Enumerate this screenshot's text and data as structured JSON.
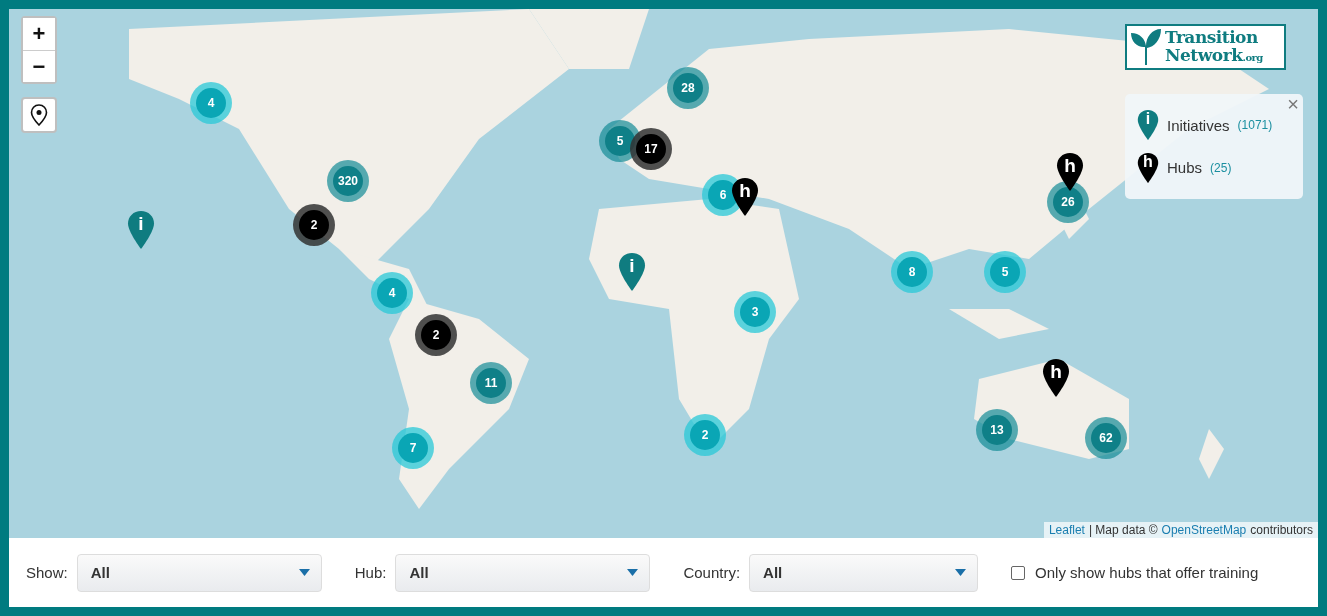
{
  "map": {
    "zoom_in": "+",
    "zoom_out": "−",
    "clusters": [
      {
        "count": "4",
        "kind": "small"
      },
      {
        "count": "320",
        "kind": "large"
      },
      {
        "count": "2",
        "kind": "hub"
      },
      {
        "count": "4",
        "kind": "small"
      },
      {
        "count": "2",
        "kind": "hub"
      },
      {
        "count": "11",
        "kind": "large"
      },
      {
        "count": "7",
        "kind": "small"
      },
      {
        "count": "28",
        "kind": "large"
      },
      {
        "count": "5",
        "kind": "large"
      },
      {
        "count": "17",
        "kind": "hub"
      },
      {
        "count": "6",
        "kind": "small"
      },
      {
        "count": "3",
        "kind": "small"
      },
      {
        "count": "2",
        "kind": "small"
      },
      {
        "count": "8",
        "kind": "small"
      },
      {
        "count": "5",
        "kind": "small"
      },
      {
        "count": "26",
        "kind": "large"
      },
      {
        "count": "13",
        "kind": "large"
      },
      {
        "count": "62",
        "kind": "large"
      }
    ],
    "pins": [
      {
        "label": "i",
        "kind": "initiative"
      },
      {
        "label": "i",
        "kind": "initiative"
      },
      {
        "label": "h",
        "kind": "hub"
      },
      {
        "label": "h",
        "kind": "hub"
      },
      {
        "label": "h",
        "kind": "hub"
      }
    ],
    "logo": {
      "line1": "Transition",
      "line2": "Network",
      "suffix": ".org"
    },
    "legend": {
      "close": "×",
      "items": [
        {
          "icon": "i",
          "kind": "initiative",
          "label": "Initiatives",
          "count": "(1071)"
        },
        {
          "icon": "h",
          "kind": "hub",
          "label": "Hubs",
          "count": "(25)"
        }
      ]
    },
    "attribution": {
      "link1": "Leaflet",
      "sep": "| Map data ©",
      "link2": "OpenStreetMap",
      "rest": "contributors"
    }
  },
  "filters": [
    {
      "label": "Show:",
      "value": "All"
    },
    {
      "label": "Hub:",
      "value": "All"
    },
    {
      "label": "Country:",
      "value": "All"
    }
  ],
  "training": {
    "label": "Only show hubs that offer training",
    "checked": false
  }
}
